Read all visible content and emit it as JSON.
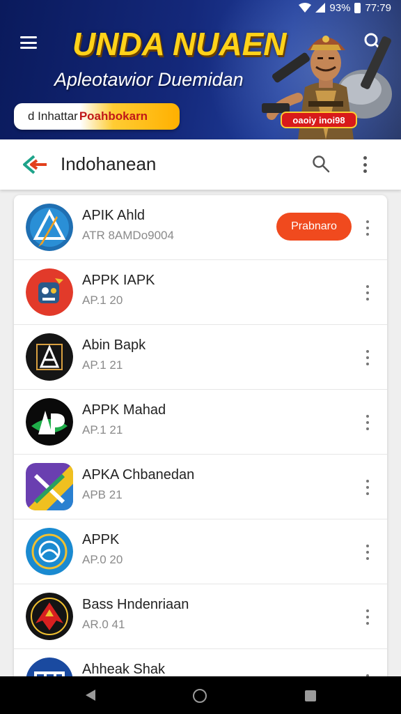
{
  "status": {
    "battery": "93%",
    "time": "77:79"
  },
  "banner": {
    "title": "UNDA NUAEN",
    "subtitle": "Apleotawior Duemidan",
    "pill_left": "d Inhattar",
    "pill_right": "Poahbokarn",
    "badge": "oaoiy inoi98"
  },
  "appbar": {
    "title": "Indohanean"
  },
  "apps": [
    {
      "name": "APIK Ahld",
      "meta": "ATR 8AMDo9004",
      "action": "Prabnaro",
      "icon": "triangle-pencil-icon"
    },
    {
      "name": "APPK IAPK",
      "meta": "AP.1 20",
      "icon": "red-robot-icon"
    },
    {
      "name": "Abin Bapk",
      "meta": "AP.1 21",
      "icon": "letter-a-frame-icon"
    },
    {
      "name": "APPK Mahad",
      "meta": "AP.1 21",
      "icon": "ap-logo-icon"
    },
    {
      "name": "APKA Chbanedan",
      "meta": "APB 21",
      "icon": "colorful-x-icon"
    },
    {
      "name": "APPK",
      "meta": "AP.0 20",
      "icon": "blue-emblem-icon"
    },
    {
      "name": "Bass Hndenriaan",
      "meta": "AR.0 41",
      "icon": "red-garuda-icon"
    },
    {
      "name": "Ahheak Shak",
      "meta": "",
      "icon": "blue-letters-icon"
    }
  ]
}
